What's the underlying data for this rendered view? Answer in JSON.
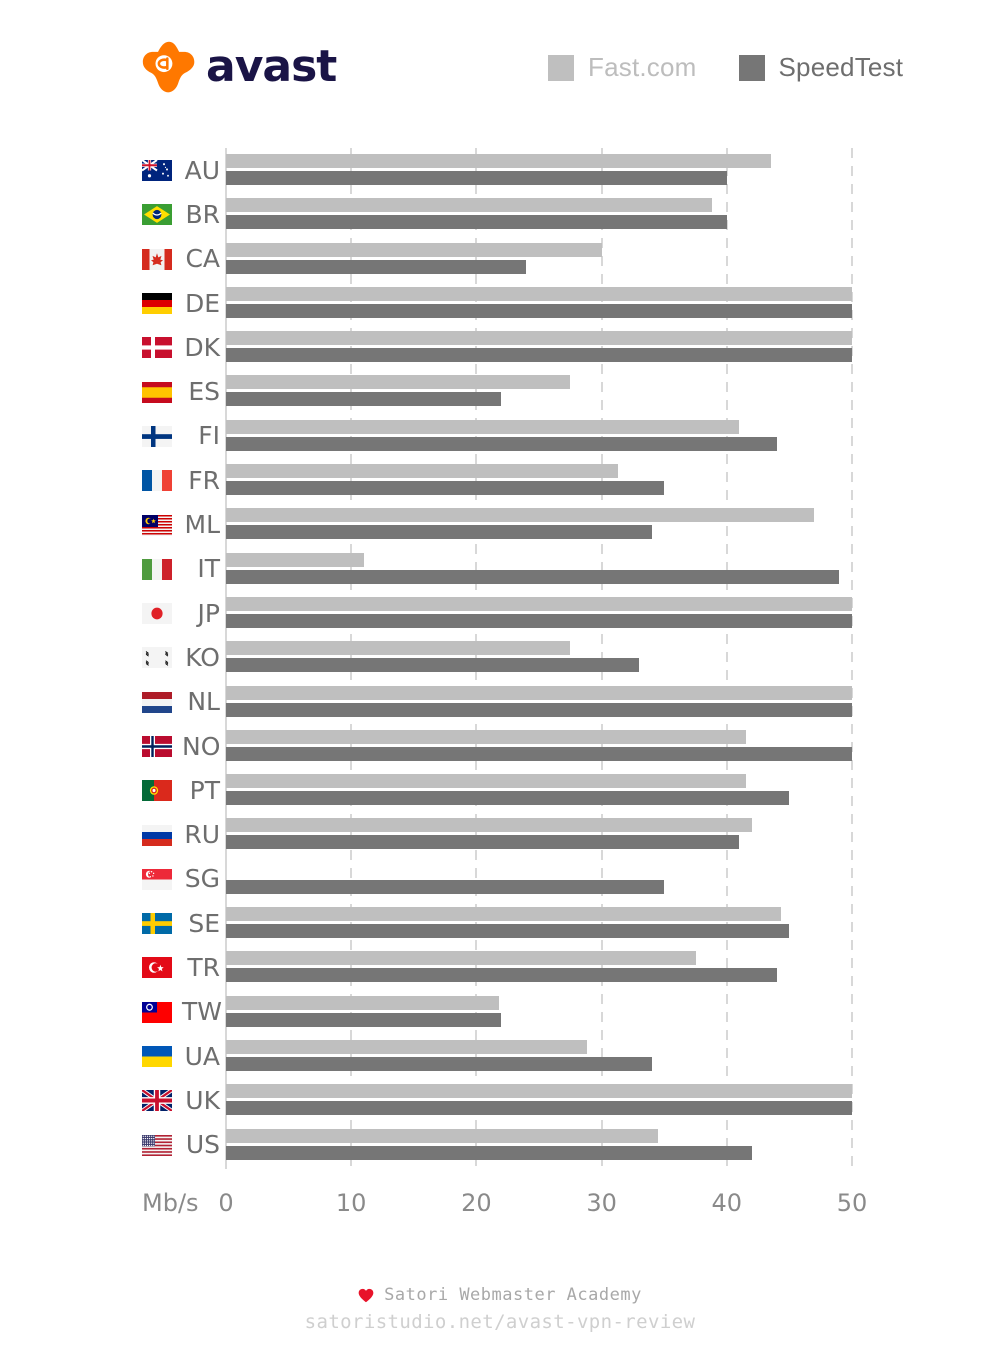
{
  "header": {
    "logo_text": "avast",
    "logo_icon": "avast-logo-icon",
    "logo_color": "#ff7800",
    "wordmark_color": "#1a1446"
  },
  "legend": {
    "items": [
      {
        "label": "Fast.com",
        "color": "#bfbfbf",
        "icon": "legend-swatch-icon"
      },
      {
        "label": "SpeedTest",
        "color": "#767676",
        "icon": "legend-swatch-icon"
      }
    ]
  },
  "axis": {
    "unit": "Mb/s",
    "ticks": [
      "0",
      "10",
      "20",
      "30",
      "40",
      "50"
    ]
  },
  "footer": {
    "heart_icon": "heart-icon",
    "heart_color": "#e8132a",
    "brand": "Satori Webmaster Academy",
    "url": "satoristudio.net/avast-vpn-review"
  },
  "chart_data": {
    "type": "bar",
    "orientation": "horizontal",
    "title": "",
    "xlabel": "Mb/s",
    "ylabel": "",
    "xlim": [
      0,
      50
    ],
    "xticks": [
      0,
      10,
      20,
      30,
      40,
      50
    ],
    "grid": true,
    "legend_position": "top-right",
    "categories": [
      "AU",
      "BR",
      "CA",
      "DE",
      "DK",
      "ES",
      "FI",
      "FR",
      "ML",
      "IT",
      "JP",
      "KO",
      "NL",
      "NO",
      "PT",
      "RU",
      "SG",
      "SE",
      "TR",
      "TW",
      "UA",
      "UK",
      "US"
    ],
    "category_flags": [
      "🇦🇺",
      "🇧🇷",
      "🇨🇦",
      "🇩🇪",
      "🇩🇰",
      "🇪🇸",
      "🇫🇮",
      "🇫🇷",
      "🇲🇾",
      "🇮🇹",
      "🇯🇵",
      "🇰🇷",
      "🇳🇱",
      "🇳🇴",
      "🇵🇹",
      "🇷🇺",
      "🇸🇬",
      "🇸🇪",
      "🇹🇷",
      "🇹🇼",
      "🇺🇦",
      "🇬🇧",
      "🇺🇸"
    ],
    "series": [
      {
        "name": "Fast.com",
        "color": "#bfbfbf",
        "values": [
          43.5,
          38.8,
          30.0,
          50.0,
          50.0,
          27.5,
          41.0,
          31.3,
          47.0,
          11.0,
          50.0,
          27.5,
          50.0,
          41.5,
          41.5,
          42.0,
          0,
          44.3,
          37.5,
          21.8,
          28.8,
          50.0,
          34.5
        ]
      },
      {
        "name": "SpeedTest",
        "color": "#767676",
        "values": [
          40.0,
          40.0,
          24.0,
          50.0,
          50.0,
          22.0,
          44.0,
          35.0,
          34.0,
          49.0,
          50.0,
          33.0,
          50.0,
          50.0,
          45.0,
          41.0,
          35.0,
          45.0,
          44.0,
          22.0,
          34.0,
          50.0,
          42.0
        ]
      }
    ]
  },
  "flags": {
    "AU": {
      "name": "flag-australia"
    },
    "BR": {
      "name": "flag-brazil"
    },
    "CA": {
      "name": "flag-canada"
    },
    "DE": {
      "name": "flag-germany"
    },
    "DK": {
      "name": "flag-denmark"
    },
    "ES": {
      "name": "flag-spain"
    },
    "FI": {
      "name": "flag-finland"
    },
    "FR": {
      "name": "flag-france"
    },
    "ML": {
      "name": "flag-malaysia"
    },
    "IT": {
      "name": "flag-italy"
    },
    "JP": {
      "name": "flag-japan"
    },
    "KO": {
      "name": "flag-south-korea"
    },
    "NL": {
      "name": "flag-netherlands"
    },
    "NO": {
      "name": "flag-norway"
    },
    "PT": {
      "name": "flag-portugal"
    },
    "RU": {
      "name": "flag-russia"
    },
    "SG": {
      "name": "flag-singapore"
    },
    "SE": {
      "name": "flag-sweden"
    },
    "TR": {
      "name": "flag-turkey"
    },
    "TW": {
      "name": "flag-taiwan"
    },
    "UA": {
      "name": "flag-ukraine"
    },
    "UK": {
      "name": "flag-united-kingdom"
    },
    "US": {
      "name": "flag-united-states"
    }
  }
}
